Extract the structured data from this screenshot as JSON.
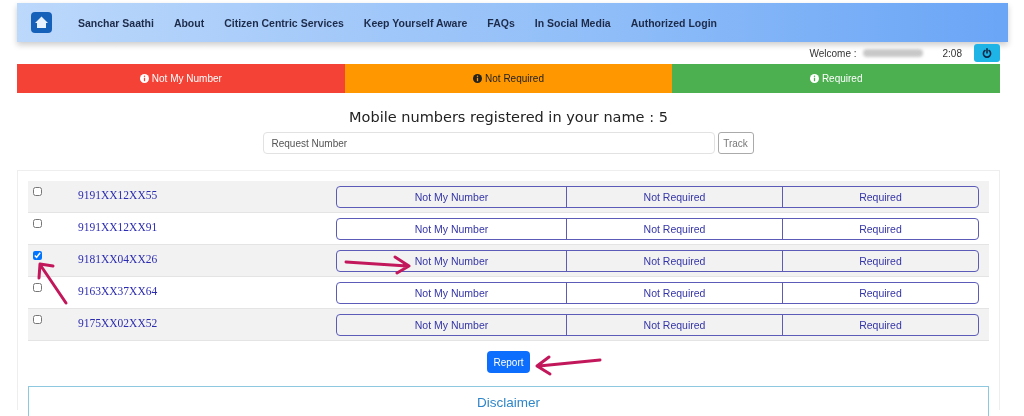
{
  "nav": {
    "items": [
      "Sanchar Saathi",
      "About",
      "Citizen Centric Services",
      "Keep Yourself Aware",
      "FAQs",
      "In Social Media",
      "Authorized Login"
    ]
  },
  "user_bar": {
    "welcome": "Welcome :",
    "time": "2:08"
  },
  "legend": [
    {
      "label": "Not My Number",
      "color": "#f44336"
    },
    {
      "label": "Not Required",
      "color": "#ff9800"
    },
    {
      "label": "Required",
      "color": "#4caf50"
    }
  ],
  "heading": "Mobile numbers registered in your name : 5",
  "request": {
    "placeholder": "Request Number",
    "button": "Track"
  },
  "rows": [
    {
      "number": "9191XX12XX55",
      "checked": false,
      "options": [
        "Not My Number",
        "Not Required",
        "Required"
      ]
    },
    {
      "number": "9191XX12XX91",
      "checked": false,
      "options": [
        "Not My Number",
        "Not Required",
        "Required"
      ]
    },
    {
      "number": "9181XX04XX26",
      "checked": true,
      "options": [
        "Not My Number",
        "Not Required",
        "Required"
      ]
    },
    {
      "number": "9163XX37XX64",
      "checked": false,
      "options": [
        "Not My Number",
        "Not Required",
        "Required"
      ]
    },
    {
      "number": "9175XX02XX52",
      "checked": false,
      "options": [
        "Not My Number",
        "Not Required",
        "Required"
      ]
    }
  ],
  "report_button": "Report",
  "disclaimer": {
    "title": "Disclaimer"
  }
}
